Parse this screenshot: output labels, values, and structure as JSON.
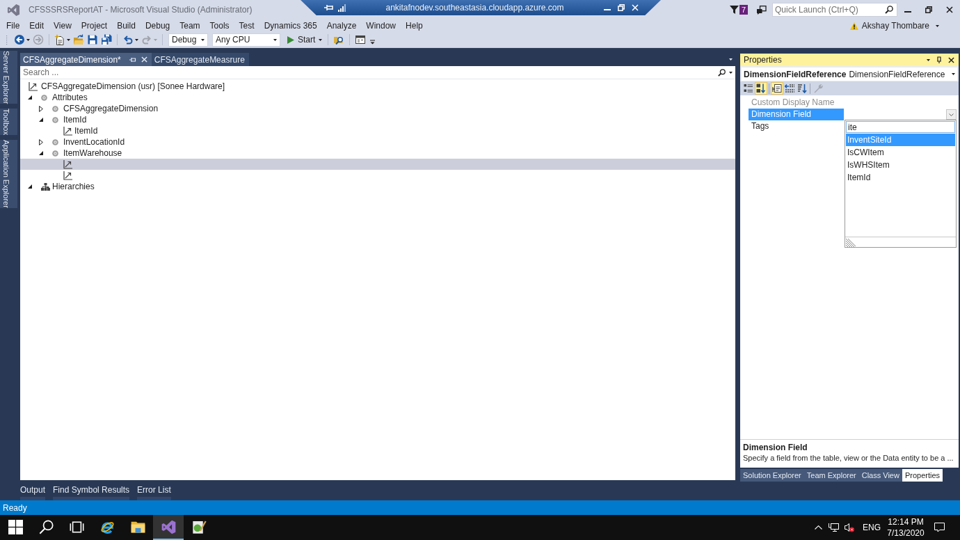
{
  "window": {
    "title": "CFSSSRSReportAT - Microsoft Visual Studio (Administrator)",
    "notifications": "7",
    "quick_launch": {
      "placeholder": "Quick Launch (Ctrl+Q)"
    },
    "user": "Akshay Thombare"
  },
  "remote_session": {
    "host": "ankitafnodev.southeastasia.cloudapp.azure.com"
  },
  "menu": [
    "File",
    "Edit",
    "View",
    "Project",
    "Build",
    "Debug",
    "Team",
    "Tools",
    "Test",
    "Dynamics 365",
    "Analyze",
    "Window",
    "Help"
  ],
  "toolbar": [
    {
      "kind": "back",
      "disabled": false
    },
    {
      "kind": "forward",
      "disabled": true
    },
    {
      "kind": "separator"
    },
    {
      "kind": "new",
      "disabled": false
    },
    {
      "kind": "open",
      "disabled": false
    },
    {
      "kind": "save",
      "disabled": false
    },
    {
      "kind": "saveall",
      "disabled": false
    },
    {
      "kind": "separator"
    },
    {
      "kind": "undo",
      "disabled": false
    },
    {
      "kind": "redo",
      "disabled": true
    },
    {
      "kind": "separator"
    },
    {
      "kind": "select",
      "value": "Debug"
    },
    {
      "kind": "select",
      "value": "Any CPU"
    },
    {
      "kind": "start",
      "label": "Start"
    },
    {
      "kind": "separator"
    },
    {
      "kind": "find",
      "disabled": false
    },
    {
      "kind": "separator"
    },
    {
      "kind": "layout",
      "disabled": false
    }
  ],
  "side_tabs": [
    "Server Explorer",
    "Toolbox",
    "Application Explorer"
  ],
  "document": {
    "tabs": [
      {
        "label": "CFSAggregateDimension*",
        "selected": true
      },
      {
        "label": "CFSAggregateMeasrure",
        "selected": false
      }
    ],
    "search": {
      "placeholder": "Search ..."
    },
    "tree": {
      "label": "CFSAggregateDimension (usr) [Sonee Hardware]",
      "kind": "field",
      "selected": false,
      "children": [
        {
          "label": "Attributes",
          "kind": "attribute",
          "expanded": true,
          "selected": false,
          "children": [
            {
              "label": "CFSAggregateDimension",
              "kind": "attribute",
              "expanded": false,
              "selected": false
            },
            {
              "label": "ItemId",
              "kind": "attribute",
              "expanded": true,
              "selected": false,
              "children": [
                {
                  "label": "ItemId",
                  "kind": "field",
                  "selected": false
                }
              ]
            },
            {
              "label": "InventLocationId",
              "kind": "attribute",
              "expanded": false,
              "selected": false
            },
            {
              "label": "ItemWarehouse",
              "kind": "attribute",
              "expanded": true,
              "selected": false,
              "children": [
                {
                  "kind": "field",
                  "selected": true
                },
                {
                  "kind": "field",
                  "selected": false
                }
              ]
            }
          ]
        },
        {
          "label": "Hierarchies",
          "kind": "hierarchy",
          "expanded": true,
          "selected": false
        }
      ]
    }
  },
  "output_tabs": [
    "Output",
    "Find Symbol Results",
    "Error List"
  ],
  "properties": {
    "title": "Properties",
    "object": {
      "name": "DimensionFieldReference",
      "type": "DimensionFieldReference"
    },
    "toolbar": [
      {
        "kind": "categorized",
        "pressed": false,
        "disabled": false
      },
      {
        "kind": "alphabetical",
        "pressed": true,
        "disabled": false
      },
      {
        "kind": "separator"
      },
      {
        "kind": "properties",
        "pressed": true,
        "disabled": false
      },
      {
        "kind": "collapse",
        "pressed": false,
        "disabled": false
      },
      {
        "kind": "sort",
        "pressed": false,
        "disabled": false
      },
      {
        "kind": "separator"
      },
      {
        "kind": "settings",
        "pressed": false,
        "disabled": true
      }
    ],
    "rows": [
      {
        "name": "Custom Display Name",
        "selected": false,
        "disabled": true
      },
      {
        "name": "Dimension Field",
        "selected": true,
        "disabled": false
      },
      {
        "name": "Tags",
        "selected": false,
        "disabled": false
      }
    ],
    "dropdown": {
      "value": "ite",
      "options": [
        {
          "label": "InventSiteId",
          "selected": true
        },
        {
          "label": "IsCWItem",
          "selected": false
        },
        {
          "label": "IsWHSItem",
          "selected": false
        },
        {
          "label": "ItemId",
          "selected": false
        }
      ]
    },
    "description": {
      "title": "Dimension Field",
      "text": "Specify a field from the table, view or the Data entity to be a ..."
    }
  },
  "tool_tabs": [
    {
      "label": "Solution Explorer",
      "selected": false
    },
    {
      "label": "Team Explorer",
      "selected": false
    },
    {
      "label": "Class View",
      "selected": false
    },
    {
      "label": "Properties",
      "selected": true
    }
  ],
  "status_bar": {
    "text": "Ready"
  },
  "taskbar": {
    "buttons": [
      {
        "kind": "start",
        "selected": false
      },
      {
        "kind": "search",
        "selected": false
      },
      {
        "kind": "taskview",
        "selected": false
      },
      {
        "kind": "browser",
        "selected": false
      },
      {
        "kind": "folder",
        "selected": false
      },
      {
        "kind": "studio",
        "selected": true
      },
      {
        "kind": "editor",
        "selected": false
      }
    ],
    "tray": {
      "language": "ENG",
      "time": "12:14 PM",
      "date": "7/13/2020"
    }
  }
}
